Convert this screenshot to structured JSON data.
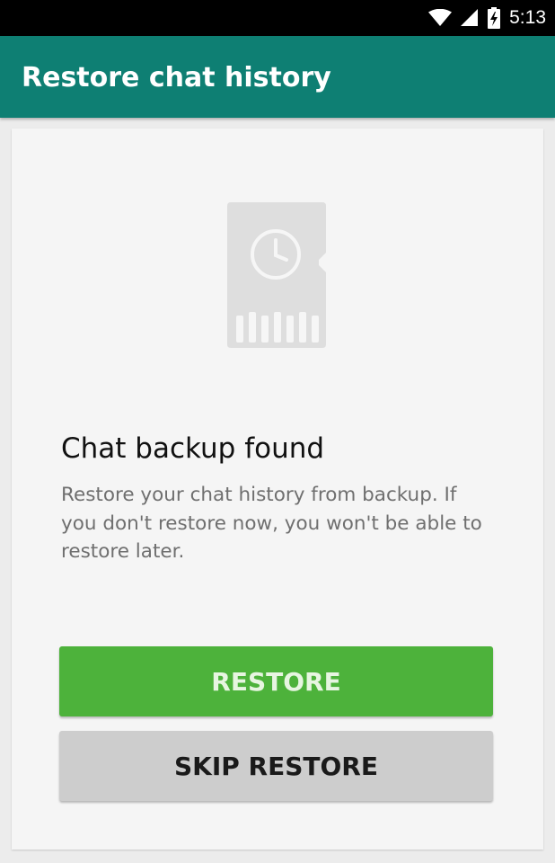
{
  "status_bar": {
    "time": "5:13",
    "icons": [
      "wifi-icon",
      "cell-signal-icon",
      "battery-charging-icon"
    ]
  },
  "app_bar": {
    "title": "Restore chat history"
  },
  "content": {
    "illustration": "sd-card-clock-icon",
    "headline": "Chat backup found",
    "body": "Restore your chat history from backup. If you don't restore now, you won't be able to restore later."
  },
  "buttons": {
    "restore_label": "RESTORE",
    "skip_label": "SKIP RESTORE"
  },
  "colors": {
    "app_bar": "#0e7f73",
    "restore_button": "#4db23b",
    "skip_button": "#cdcdcd"
  }
}
